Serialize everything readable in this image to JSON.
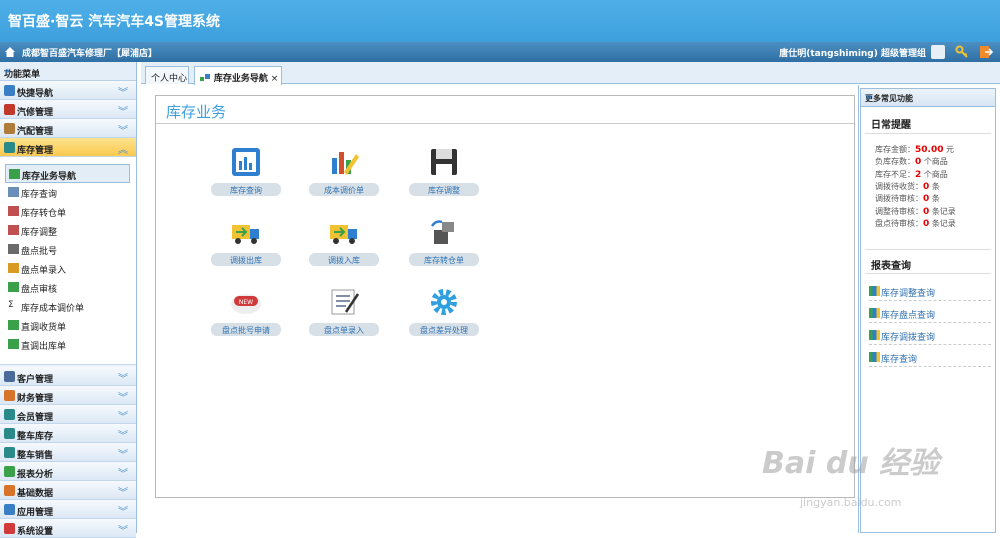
{
  "app": {
    "title": "智百盛·智云 汽车汽车4S管理系统"
  },
  "subbar": {
    "shop": "成都智百盛汽车修理厂【犀浦店】",
    "user": "唐仕明(tangshiming) 超级管理组"
  },
  "sidebar": {
    "header": "功能菜单",
    "collapse_glyph": "«",
    "sections_top": [
      {
        "label": "快捷导航",
        "icon": "compass-icon",
        "color": "#3a7fc4"
      },
      {
        "label": "汽修管理",
        "icon": "tools-icon",
        "color": "#c0392b"
      },
      {
        "label": "汽配管理",
        "icon": "parts-icon",
        "color": "#b07a3a"
      },
      {
        "label": "库存管理",
        "icon": "warehouse-icon",
        "color": "#2a8a8a"
      }
    ],
    "active_section": "库存管理",
    "sub_items": [
      {
        "label": "库存业务导航",
        "icon": "nav-icon",
        "color": "#3aa04a"
      },
      {
        "label": "库存查询",
        "icon": "list-icon",
        "color": "#6b8fb8"
      },
      {
        "label": "库存转仓单",
        "icon": "table-icon",
        "color": "#c05050"
      },
      {
        "label": "库存调整",
        "icon": "table-icon",
        "color": "#c05050"
      },
      {
        "label": "盘点批号",
        "icon": "disk-icon",
        "color": "#6a6a6a"
      },
      {
        "label": "盘点单录入",
        "icon": "pencil-icon",
        "color": "#d89a20"
      },
      {
        "label": "盘点审核",
        "icon": "check-icon",
        "color": "#3aa04a"
      },
      {
        "label": "库存成本调价单",
        "icon": "sigma-icon",
        "color": "#333333",
        "glyph": "Σ"
      },
      {
        "label": "直调收货单",
        "icon": "nav-icon",
        "color": "#3aa04a"
      },
      {
        "label": "直调出库单",
        "icon": "nav-icon",
        "color": "#3aa04a"
      }
    ],
    "sections_bottom": [
      {
        "label": "客户管理",
        "icon": "customer-icon",
        "color": "#4a6a9a"
      },
      {
        "label": "财务管理",
        "icon": "finance-icon",
        "color": "#d8742a"
      },
      {
        "label": "会员管理",
        "icon": "member-icon",
        "color": "#2a8a8a"
      },
      {
        "label": "整车库存",
        "icon": "car-stock-icon",
        "color": "#2a8a8a"
      },
      {
        "label": "整车销售",
        "icon": "car-sale-icon",
        "color": "#2a8a8a"
      },
      {
        "label": "报表分析",
        "icon": "pie-icon",
        "color": "#3aa04a"
      },
      {
        "label": "基础数据",
        "icon": "data-icon",
        "color": "#d8742a"
      },
      {
        "label": "应用管理",
        "icon": "app-icon",
        "color": "#3a7fc4"
      },
      {
        "label": "系统设置",
        "icon": "settings-icon",
        "color": "#d03a3a"
      }
    ],
    "chevron_down": "︾",
    "chevron_up": "︽"
  },
  "tabs": [
    {
      "label": "个人中心"
    },
    {
      "label": "库存业务导航",
      "close": "×"
    }
  ],
  "main": {
    "title": "库存业务",
    "items": [
      {
        "label": "库存查询",
        "icon": "chart-screen-icon",
        "color": "#2f7fd0"
      },
      {
        "label": "成本调价单",
        "icon": "bar-edit-icon",
        "color": "#d05030"
      },
      {
        "label": "库存调整",
        "icon": "floppy-icon",
        "color": "#333333"
      },
      {
        "label": "调拨出库",
        "icon": "truck-out-icon",
        "color": "#2f7fd0"
      },
      {
        "label": "调拨入库",
        "icon": "truck-in-icon",
        "color": "#2f7fd0"
      },
      {
        "label": "库存转仓单",
        "icon": "transfer-icon",
        "color": "#555555"
      },
      {
        "label": "盘点批号申请",
        "icon": "new-badge-icon",
        "color": "#d03a3a",
        "badge": "NEW"
      },
      {
        "label": "盘点单录入",
        "icon": "form-pen-icon",
        "color": "#5a6a8a"
      },
      {
        "label": "盘点差异处理",
        "icon": "gear-icon",
        "color": "#2f9fe0"
      }
    ]
  },
  "right": {
    "header": "更多常见功能",
    "expand_glyph": "»",
    "daily_title": "日常提醒",
    "stats": [
      {
        "label": "库存金额：",
        "value": "50.00",
        "unit": "元"
      },
      {
        "label": "负库存数：",
        "value": "0",
        "unit": "个商品"
      },
      {
        "label": "库存不足：",
        "value": "2",
        "unit": "个商品"
      },
      {
        "label": "调拨待收货：",
        "value": "0",
        "unit": "条"
      },
      {
        "label": "调拨待审核：",
        "value": "0",
        "unit": "条"
      },
      {
        "label": "调整待审核：",
        "value": "0",
        "unit": "条记录"
      },
      {
        "label": "盘点待审核：",
        "value": "0",
        "unit": "条记录"
      }
    ],
    "report_title": "报表查询",
    "reports": [
      {
        "label": "库存调整查询"
      },
      {
        "label": "库存盘点查询"
      },
      {
        "label": "库存调拨查询"
      },
      {
        "label": "库存查询"
      }
    ]
  },
  "watermark": {
    "main": "Bai du 经验",
    "sub": "jingyan.baidu.com"
  }
}
